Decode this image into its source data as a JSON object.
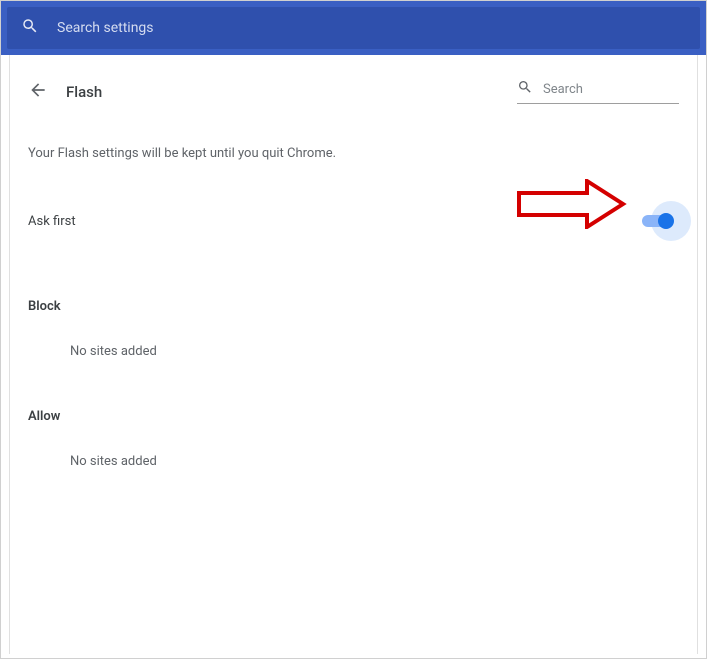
{
  "topbar": {
    "search_placeholder": "Search settings"
  },
  "header": {
    "title": "Flash",
    "search_placeholder": "Search"
  },
  "description": "Your Flash settings will be kept until you quit Chrome.",
  "toggle": {
    "label": "Ask first",
    "state": true
  },
  "sections": {
    "block": {
      "heading": "Block",
      "empty": "No sites added"
    },
    "allow": {
      "heading": "Allow",
      "empty": "No sites added"
    }
  }
}
